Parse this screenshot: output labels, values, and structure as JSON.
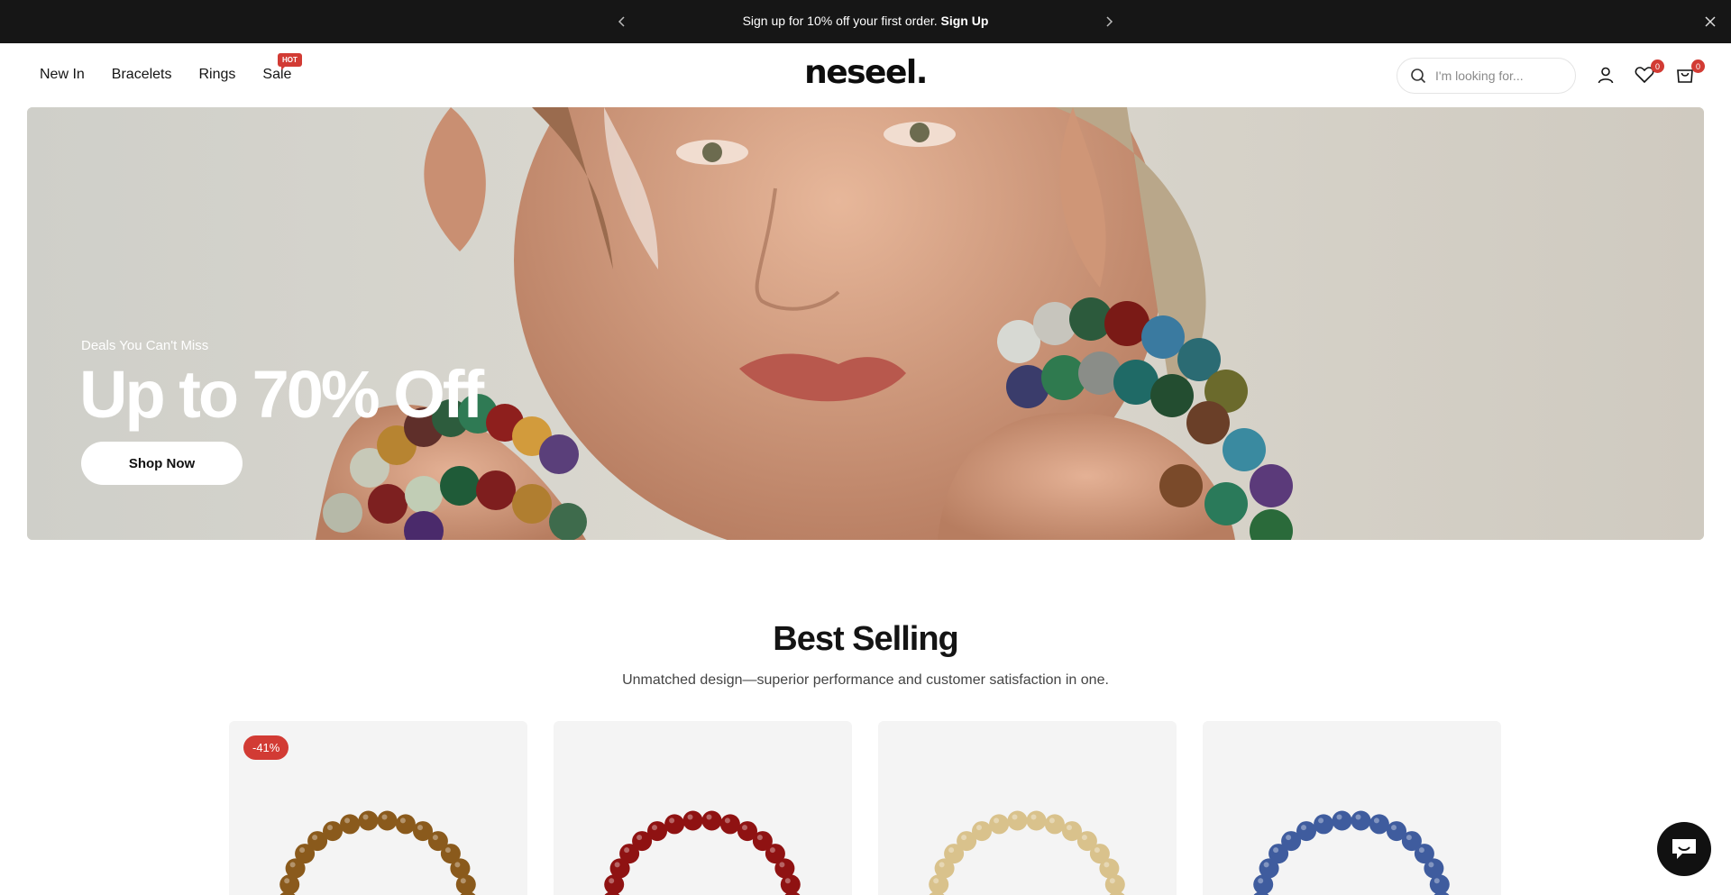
{
  "announcement": {
    "text": "Sign up for 10% off your first order.",
    "link": "Sign Up"
  },
  "nav": {
    "items": [
      {
        "label": "New In"
      },
      {
        "label": "Bracelets"
      },
      {
        "label": "Rings"
      },
      {
        "label": "Sale"
      }
    ],
    "sale_badge": "HOT"
  },
  "brand": {
    "logo": "neseel."
  },
  "search": {
    "placeholder": "I'm looking for..."
  },
  "header_icons": {
    "account": "user-icon",
    "wishlist": "heart-icon",
    "wishlist_count": "0",
    "cart": "bag-icon",
    "cart_count": "0"
  },
  "hero": {
    "eyebrow": "Deals You Can't Miss",
    "headline": "Up to 70% Off",
    "cta": "Shop Now"
  },
  "best_selling": {
    "title": "Best Selling",
    "subtitle": "Unmatched design—superior performance and customer satisfaction in one.",
    "products": [
      {
        "badge": "-41%",
        "bead_color": "#8a5a1c"
      },
      {
        "badge": "",
        "bead_color": "#8f1212"
      },
      {
        "badge": "",
        "bead_color": "#d9c28c"
      },
      {
        "badge": "",
        "bead_color": "#3f5c9e"
      }
    ]
  },
  "colors": {
    "announcement_bg": "#161616",
    "accent_red": "#d23b34"
  }
}
